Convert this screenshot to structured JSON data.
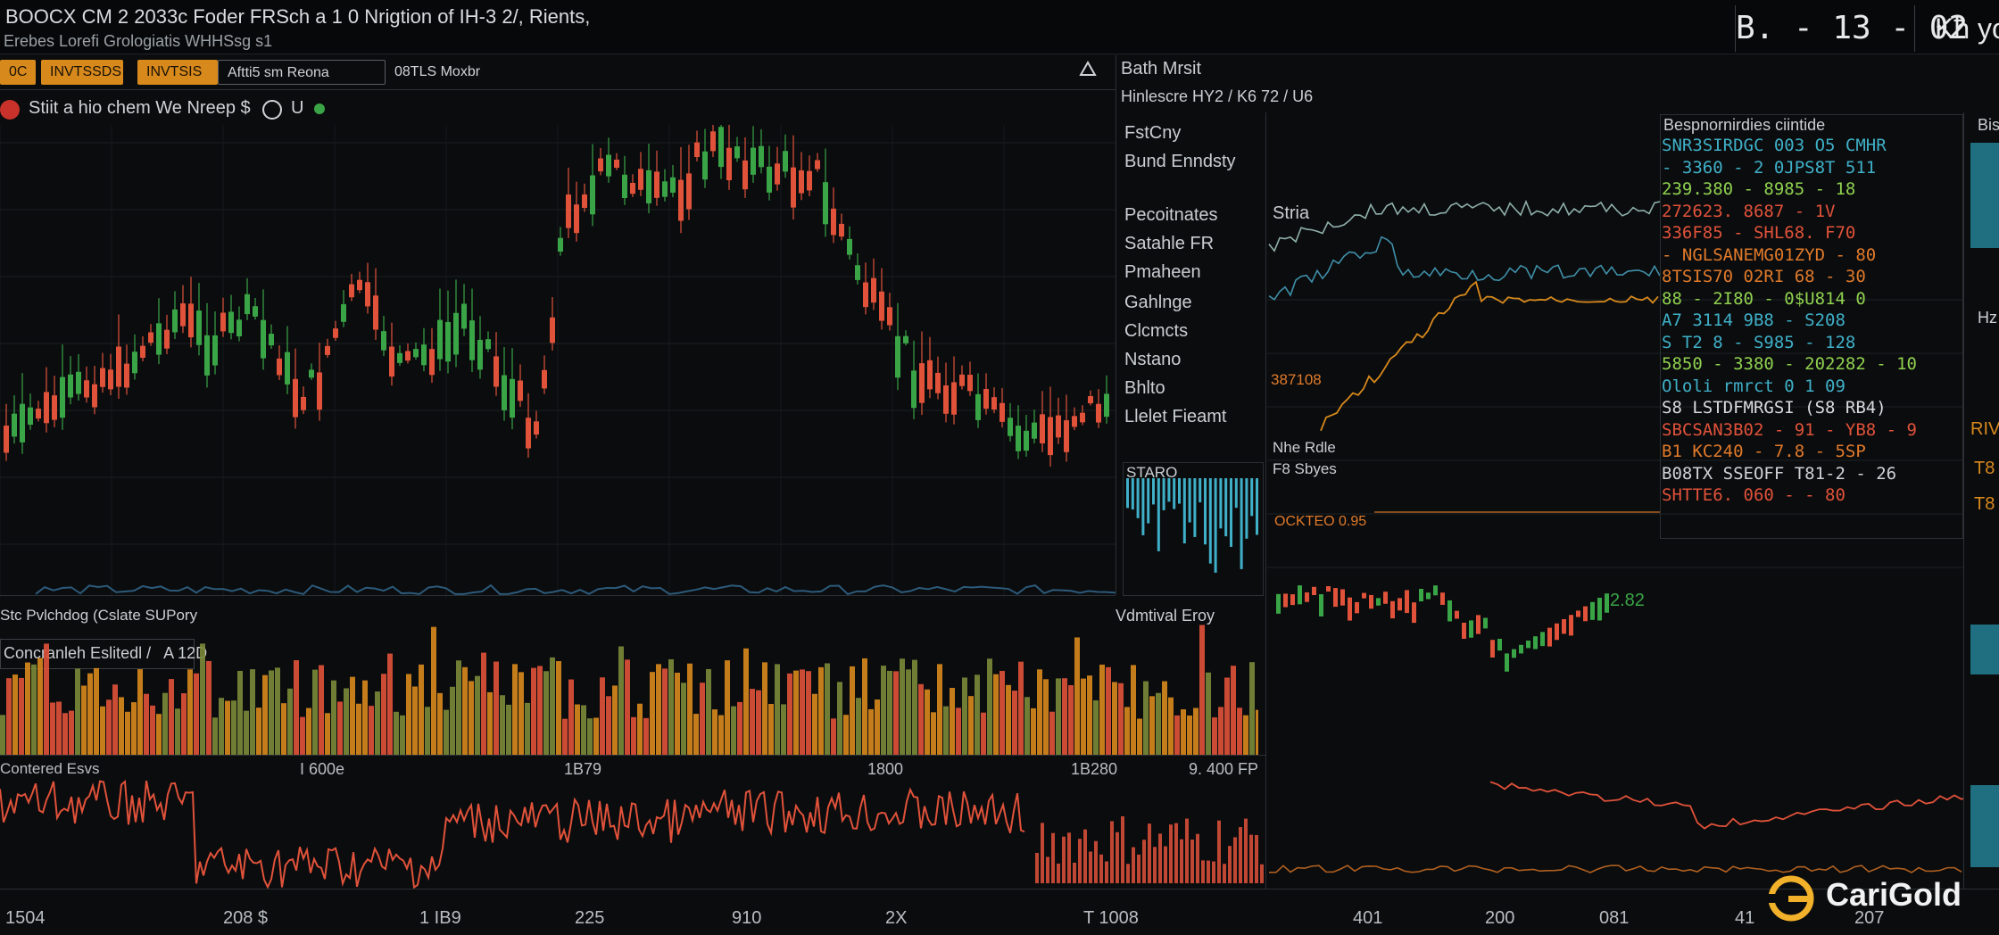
{
  "header": {
    "title": "BOOCX CM 2 2033c Foder FRSch a 1 0 Nrigtion of IH-3 2/, Rients,",
    "subtitle": "Erebes Lorefi Grologiatis WHHSsg s1",
    "clock": "B. - 13 - 02",
    "clock_suffix": "Kħ yo"
  },
  "toolbar": {
    "btn1": "0C",
    "btn2": "INVTSSDS",
    "btn3": "INVTSIS",
    "btn4": "Aftti5 sm Reona",
    "btn5": "08TLS Moxbr"
  },
  "symbol_row": {
    "text": "Stiit a hio chem We Nreep $",
    "suffix": "U"
  },
  "side_panel": {
    "header": "Bath Mrsit",
    "subheader": "Hinlescre HY2 / K6 72 / U6",
    "items": [
      "FstCny",
      "Bund Enndsty",
      "Pecoitnates",
      "Satahle FR",
      "Pmaheen",
      "Gahlnge",
      "Clcmcts",
      "Nstano",
      "Bhlto",
      "Llelet Fieamt"
    ],
    "mini_label": "STARO",
    "volume_label": "Vdmtival Eroy"
  },
  "right_panel": {
    "header": "Bespnornirdies ciintide",
    "sub_label": "Stria",
    "left_labels": [
      "387108",
      "Nhe Rdle",
      "F8 Sbyes",
      "OCKTEO 0.95"
    ],
    "price_label": "2.82",
    "rows": [
      {
        "text": "SNR3SIRDGC 003 O5 CMHR",
        "color": "#3fb0c8"
      },
      {
        "text": "- 3360 - 2 0JPS8T 511",
        "color": "#3fb0c8"
      },
      {
        "text": "239.380 - 8985 - 18",
        "color": "#8fd14f"
      },
      {
        "text": "272623. 8687 - 1V",
        "color": "#e0523a"
      },
      {
        "text": "336F85 - SHL68. F70",
        "color": "#e0523a"
      },
      {
        "text": "- NGLSANEMG01ZYD - 80",
        "color": "#e07a2a"
      },
      {
        "text": "8TSIS70 02RI 68 - 30",
        "color": "#e07a2a"
      },
      {
        "text": "88 - 2I80 - 0$U814 0",
        "color": "#8fd14f"
      },
      {
        "text": "A7 3114 9B8 - S208",
        "color": "#3fb0c8"
      },
      {
        "text": "S T2 8 - S985 - 128",
        "color": "#3fb0c8"
      },
      {
        "text": "5850 - 3380 - 202282 - 10",
        "color": "#8fd14f"
      },
      {
        "text": "Ololi rmrct 0 1 09",
        "color": "#3fb0c8"
      },
      {
        "text": "S8 LSTDFMRGSI (S8 RB4)",
        "color": "#d8dcdf"
      },
      {
        "text": "SBCSAN3B02 - 91 - YB8 - 9",
        "color": "#e0523a"
      },
      {
        "text": "B1 KC240 - 7.8 - 5SP",
        "color": "#e07a2a"
      },
      {
        "text": "B08TX SSEOFF T81-2 - 26",
        "color": "#cfd3d6"
      },
      {
        "text": "SHTTE6. 060 - - 80",
        "color": "#e0523a"
      }
    ]
  },
  "volume_panel": {
    "title": "Stc Pvlchdog (Cslate SUPory",
    "label": "Concranleh Eslitedl /   A 12D"
  },
  "lower_axis": {
    "left_label": "Contered Esvs",
    "labels": [
      "I 600e",
      "1B79",
      "1800",
      "1B280",
      "9. 400 FP"
    ]
  },
  "bottom_axis": [
    "1504",
    "208 $",
    "1 IB9",
    "225",
    "910",
    "2X",
    "T 1008",
    "401",
    "200",
    "081",
    "41",
    "207"
  ],
  "right_edge": [
    "Bis",
    "Hz",
    "RIV",
    "T8",
    "T8"
  ],
  "logo": {
    "name": "CariGold",
    "brand_color": "#f2b12a"
  },
  "colors": {
    "up": "#3aa546",
    "down": "#e0523a",
    "orange": "#d8891c",
    "cyan": "#3fb0c8",
    "bg": "#0b0c0e"
  }
}
